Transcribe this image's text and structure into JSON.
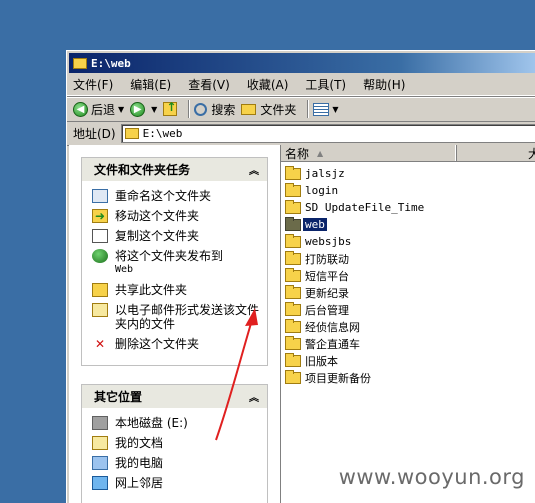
{
  "window": {
    "title": "E:\\web"
  },
  "menu": [
    "文件(F)",
    "编辑(E)",
    "查看(V)",
    "收藏(A)",
    "工具(T)",
    "帮助(H)"
  ],
  "toolbar": {
    "back": "后退",
    "search": "搜索",
    "folders": "文件夹"
  },
  "address": {
    "label": "地址(D)",
    "value": "E:\\web"
  },
  "tasks_panel": {
    "title": "文件和文件夹任务",
    "items": [
      {
        "icon": "rename-icon",
        "label": "重命名这个文件夹"
      },
      {
        "icon": "move-icon",
        "label": "移动这个文件夹"
      },
      {
        "icon": "copy-icon",
        "label": "复制这个文件夹"
      },
      {
        "icon": "publish-web-icon",
        "label": "将这个文件夹发布到",
        "sub": "Web"
      },
      {
        "icon": "share-icon",
        "label": "共享此文件夹"
      },
      {
        "icon": "email-icon",
        "label": "以电子邮件形式发送该文件夹内的文件"
      },
      {
        "icon": "delete-icon",
        "label": "删除这个文件夹"
      }
    ]
  },
  "places_panel": {
    "title": "其它位置",
    "items": [
      {
        "icon": "local-disk-icon",
        "label": "本地磁盘  (E:)"
      },
      {
        "icon": "my-documents-icon",
        "label": "我的文档"
      },
      {
        "icon": "my-computer-icon",
        "label": "我的电脑"
      },
      {
        "icon": "network-places-icon",
        "label": "网上邻居"
      }
    ]
  },
  "columns": {
    "name": "名称",
    "size": "大"
  },
  "files": [
    {
      "name": "jalsjz",
      "selected": false
    },
    {
      "name": "login",
      "selected": false
    },
    {
      "name": "SD UpdateFile_Time",
      "selected": false
    },
    {
      "name": "web",
      "selected": true
    },
    {
      "name": "websjbs",
      "selected": false
    },
    {
      "name": "打防联动",
      "selected": false
    },
    {
      "name": "短信平台",
      "selected": false
    },
    {
      "name": "更新纪录",
      "selected": false
    },
    {
      "name": "后台管理",
      "selected": false
    },
    {
      "name": "经侦信息网",
      "selected": false
    },
    {
      "name": "警企直通车",
      "selected": false
    },
    {
      "name": "旧版本",
      "selected": false
    },
    {
      "name": "项目更新备份",
      "selected": false
    }
  ],
  "watermark": "www.wooyun.org",
  "colors": {
    "desktop": "#3a6ea5",
    "titlebar": "#0a246a",
    "selection": "#0a246a",
    "arrow": "#e02020"
  }
}
